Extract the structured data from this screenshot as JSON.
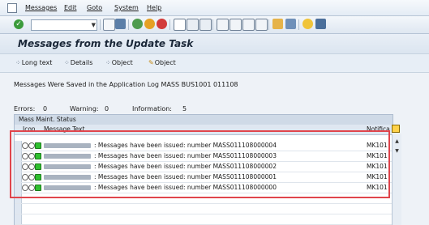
{
  "menubar": {
    "items": [
      {
        "label": "Messages",
        "underline": "M",
        "rest": "essages"
      },
      {
        "label": "Edit",
        "underline": "E",
        "rest": "dit"
      },
      {
        "label": "Goto",
        "underline": "G",
        "rest": "oto"
      },
      {
        "label": "System",
        "underline": "S",
        "rest": "ystem"
      },
      {
        "label": "Help",
        "underline": "H",
        "rest": "elp"
      }
    ]
  },
  "toolbar": {
    "command_field_value": ""
  },
  "title": "Messages from the Update Task",
  "app_toolbar": [
    {
      "label": "Long text",
      "icon": "glasses-icon"
    },
    {
      "label": "Details",
      "icon": "glasses-icon"
    },
    {
      "label": "Object",
      "icon": "glasses-icon"
    },
    {
      "label": "Object",
      "icon": "pencil-icon"
    }
  ],
  "info_line": "Messages Were Saved in the Application Log MASS BUS1001 011108",
  "counts": {
    "errors_label": "Errors:",
    "errors_value": "0",
    "warning_label": "Warning:",
    "warning_value": "0",
    "information_label": "Information:",
    "information_value": "5"
  },
  "group_header": "Mass Maint. Status",
  "columns": {
    "icon": "Icon",
    "message": "Message Text",
    "notification": "Notifica"
  },
  "rows": [
    {
      "message": ": Messages have been issued: number MASS011108000004",
      "code": "MK101"
    },
    {
      "message": ": Messages have been issued: number MASS011108000003",
      "code": "MK101"
    },
    {
      "message": ": Messages have been issued: number MASS011108000002",
      "code": "MK101"
    },
    {
      "message": ": Messages have been issued: number MASS011108000001",
      "code": "MK101"
    },
    {
      "message": ": Messages have been issued: number MASS011108000000",
      "code": "MK101"
    }
  ],
  "colors": {
    "highlight_border": "#e0454c",
    "status_green": "#2fbf2f"
  }
}
